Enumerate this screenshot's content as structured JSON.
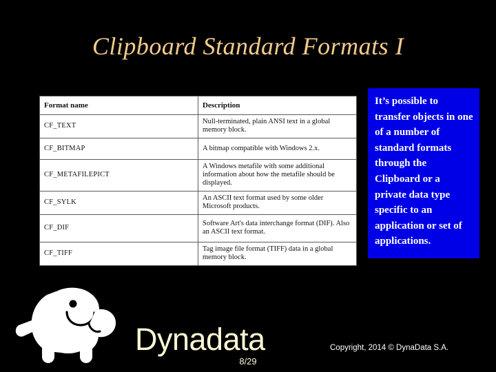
{
  "slide": {
    "title": "Clipboard Standard Formats I",
    "background_color": "#000000",
    "title_color": "#f2cb8d"
  },
  "table": {
    "headers": [
      "Format name",
      "Description"
    ],
    "rows": [
      {
        "name": "CF_TEXT",
        "description": "Null-terminated, plain ANSI text in a global memory block."
      },
      {
        "name": "CF_BITMAP",
        "description": "A bitmap compatible with Windows 2.x."
      },
      {
        "name": "CF_METAFILEPICT",
        "description": "A Windows metafile with some additional information about how the metafile should be displayed."
      },
      {
        "name": "CF_SYLK",
        "description": "An ASCII text format used by some older Microsoft products."
      },
      {
        "name": "CF_DIF",
        "description": "Software Art's data interchange format (DIF). Also an ASCII text format."
      },
      {
        "name": "CF_TIFF",
        "description": "Tag image file format (TIFF) data in a global memory block."
      }
    ]
  },
  "callout": {
    "text": "It’s possible to transfer objects in one of a number of standard formats through the Clipboard or a private data type specific to an application or set of applications.",
    "background_color": "#0000e6",
    "text_color": "#ffffff"
  },
  "footer": {
    "logo_icon": "manatee-logo-icon",
    "wordmark": "Dynadata",
    "page_number": "8/29",
    "copyright": "Copyright, 2014 © DynaData S.A.",
    "wordmark_color": "#fcf7d4"
  }
}
